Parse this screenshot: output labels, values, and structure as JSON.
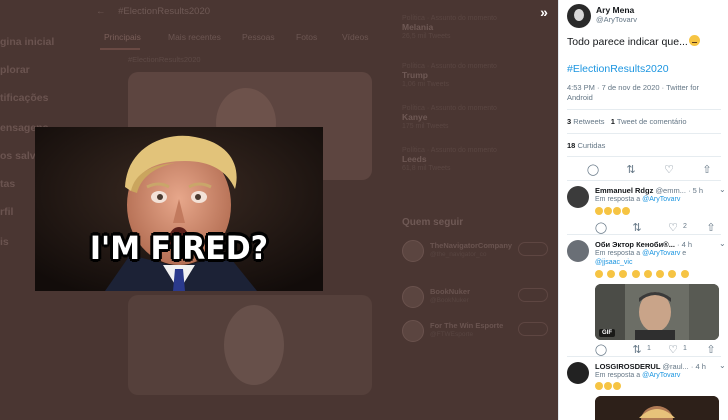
{
  "background": {
    "nav": [
      "gina inicial",
      "plorar",
      "tificações",
      "ensagens",
      "os salvo",
      "tas",
      "rfil",
      "is"
    ],
    "header_title": "#ElectionResults2020",
    "tabs": [
      "Principais",
      "Mais recentes",
      "Pessoas",
      "Fotos",
      "Vídeos"
    ],
    "sub_text": "#ElectionResults2020",
    "trends": [
      {
        "meta": "Política · Assunto do momento",
        "name": "Melania",
        "count": "26,5 mil Tweets"
      },
      {
        "meta": "Política · Assunto do momento",
        "name": "Trump",
        "count": "1,06 mi Tweets"
      },
      {
        "meta": "Política · Assunto do momento",
        "name": "Kanye",
        "count": "175 mil Tweets"
      },
      {
        "meta": "Política · Assunto do momento",
        "name": "Leeds",
        "count": "61,8 mil Tweets"
      }
    ],
    "who_title": "Quem seguir",
    "who_list": [
      {
        "name": "TheNavigatorCompany",
        "handle": "@the_navigator_co"
      },
      {
        "name": "BookNuker",
        "handle": "@BookNuker"
      },
      {
        "name": "For The Win Esporte",
        "handle": "@FTWEsporte"
      }
    ]
  },
  "media": {
    "caption": "I'M FIRED?"
  },
  "tweet": {
    "author_name": "Ary Mena",
    "author_handle": "@AryTovarv",
    "text": "Todo parece indicar que...",
    "hashtag": "#ElectionResults2020",
    "time_line": "4:53 PM · 7 de nov de 2020 · Twitter for Android",
    "retweets_count": "3",
    "retweets_label": "Retweets",
    "comments_count": "1",
    "comments_label": "Tweet de comentário",
    "likes_count": "18",
    "likes_label": "Curtidas"
  },
  "replies": [
    {
      "name": "Emmanuel Rdgz",
      "handle": "@emm...",
      "time": "· 5 h",
      "in_reply_prefix": "Em resposta a",
      "in_reply_to": "@AryTovarv",
      "reply_count": "",
      "retweet_count": "",
      "like_count": "2"
    },
    {
      "name": "Оби Эктор Кеноби®...",
      "handle": "",
      "time": "· 4 h",
      "in_reply_prefix": "Em resposta a",
      "in_reply_to": "@AryTovarv",
      "in_reply_extra": "e",
      "in_reply_to2": "@jjsaac_vic",
      "gif_badge": "GIF",
      "reply_count": "",
      "retweet_count": "1",
      "like_count": "1"
    },
    {
      "name": "LOSGIROSDERUL",
      "handle": "@raul...",
      "time": "· 4 h",
      "in_reply_prefix": "Em resposta a",
      "in_reply_to": "@AryTovarv"
    }
  ]
}
